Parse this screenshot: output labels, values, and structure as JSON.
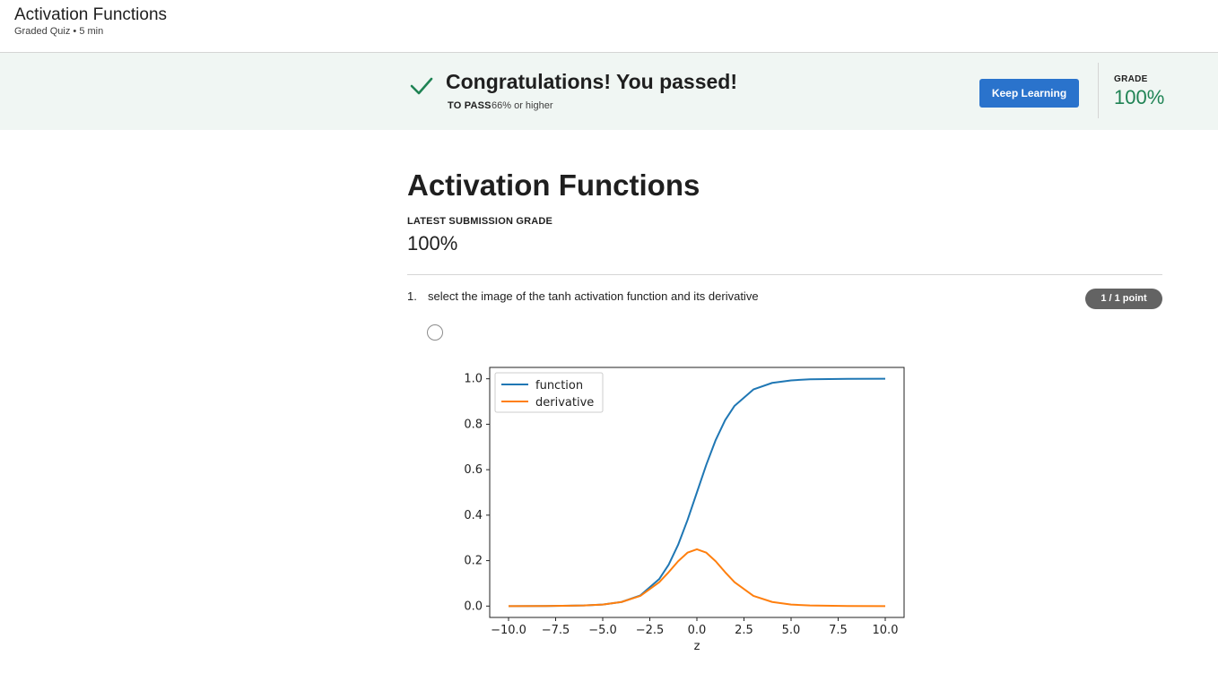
{
  "header": {
    "title": "Activation Functions",
    "subtitle": "Graded Quiz • 5 min"
  },
  "banner": {
    "message": "Congratulations! You passed!",
    "to_pass_label": "TO PASS",
    "to_pass_value": "66% or higher",
    "keep_learning_label": "Keep Learning",
    "grade_label": "GRADE",
    "grade_value": "100%",
    "success_color": "#1f8354",
    "button_color": "#2a73cc"
  },
  "main": {
    "title": "Activation Functions",
    "latest_label": "LATEST SUBMISSION GRADE",
    "latest_value": "100%"
  },
  "question": {
    "number": "1.",
    "text": "select the image of the tanh activation  function and its derivative",
    "points": "1 / 1 point"
  },
  "chart_data": {
    "type": "line",
    "xlabel": "z",
    "ylabel": "",
    "xlim": [
      -11,
      11
    ],
    "ylim": [
      -0.05,
      1.05
    ],
    "xticks": [
      "−10.0",
      "−7.5",
      "−5.0",
      "−2.5",
      "0.0",
      "2.5",
      "5.0",
      "7.5",
      "10.0"
    ],
    "xtick_values": [
      -10,
      -7.5,
      -5,
      -2.5,
      0,
      2.5,
      5,
      7.5,
      10
    ],
    "yticks": [
      "0.0",
      "0.2",
      "0.4",
      "0.6",
      "0.8",
      "1.0"
    ],
    "ytick_values": [
      0,
      0.2,
      0.4,
      0.6,
      0.8,
      1.0
    ],
    "legend_position": "top-left",
    "series": [
      {
        "name": "function",
        "color": "#1f77b4",
        "x": [
          -10,
          -8,
          -6,
          -5,
          -4,
          -3,
          -2,
          -1.5,
          -1,
          -0.5,
          0,
          0.5,
          1,
          1.5,
          2,
          3,
          4,
          5,
          6,
          8,
          10
        ],
        "y": [
          0.0,
          0.0003,
          0.0025,
          0.0067,
          0.018,
          0.047,
          0.119,
          0.182,
          0.269,
          0.378,
          0.5,
          0.622,
          0.731,
          0.818,
          0.881,
          0.953,
          0.982,
          0.993,
          0.998,
          0.9997,
          1.0
        ]
      },
      {
        "name": "derivative",
        "color": "#ff7f0e",
        "x": [
          -10,
          -8,
          -6,
          -5,
          -4,
          -3,
          -2,
          -1.5,
          -1,
          -0.5,
          0,
          0.5,
          1,
          1.5,
          2,
          3,
          4,
          5,
          6,
          8,
          10
        ],
        "y": [
          0.0,
          0.0003,
          0.0025,
          0.0066,
          0.018,
          0.045,
          0.105,
          0.149,
          0.197,
          0.235,
          0.25,
          0.235,
          0.197,
          0.149,
          0.105,
          0.045,
          0.018,
          0.0066,
          0.0025,
          0.0003,
          0.0
        ]
      }
    ]
  }
}
